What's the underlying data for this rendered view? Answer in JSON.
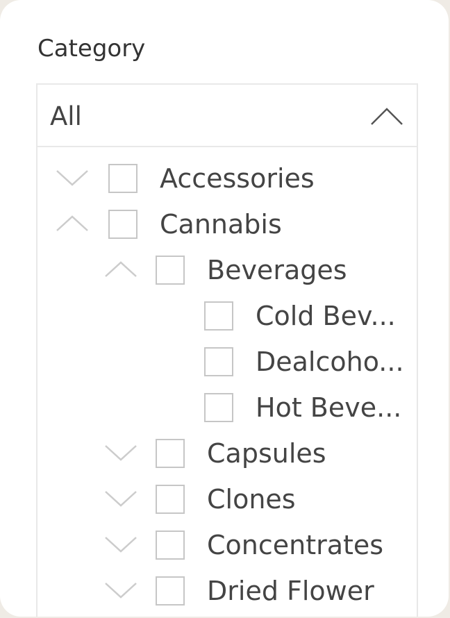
{
  "slicer": {
    "title": "Category",
    "dropdown": {
      "selected_value": "All",
      "chevron_icon": "chevron-up-icon"
    },
    "items": [
      {
        "label": "Accessories",
        "level": 0,
        "expander": "chevron-down-icon"
      },
      {
        "label": "Cannabis",
        "level": 0,
        "expander": "chevron-up-icon"
      },
      {
        "label": "Beverages",
        "level": 1,
        "expander": "chevron-up-icon"
      },
      {
        "label": "Cold Bev...",
        "level": 2,
        "expander": ""
      },
      {
        "label": "Dealcoho...",
        "level": 2,
        "expander": ""
      },
      {
        "label": "Hot Beve...",
        "level": 2,
        "expander": ""
      },
      {
        "label": "Capsules",
        "level": 1,
        "expander": "chevron-down-icon"
      },
      {
        "label": "Clones",
        "level": 1,
        "expander": "chevron-down-icon"
      },
      {
        "label": "Concentrates",
        "level": 1,
        "expander": "chevron-down-icon"
      },
      {
        "label": "Dried Flower",
        "level": 1,
        "expander": "chevron-down-icon"
      }
    ]
  },
  "colors": {
    "text": "#444444",
    "border": "#e8e8e8",
    "checkbox_border": "#c6c6c6",
    "chevron": "#cccccc"
  }
}
